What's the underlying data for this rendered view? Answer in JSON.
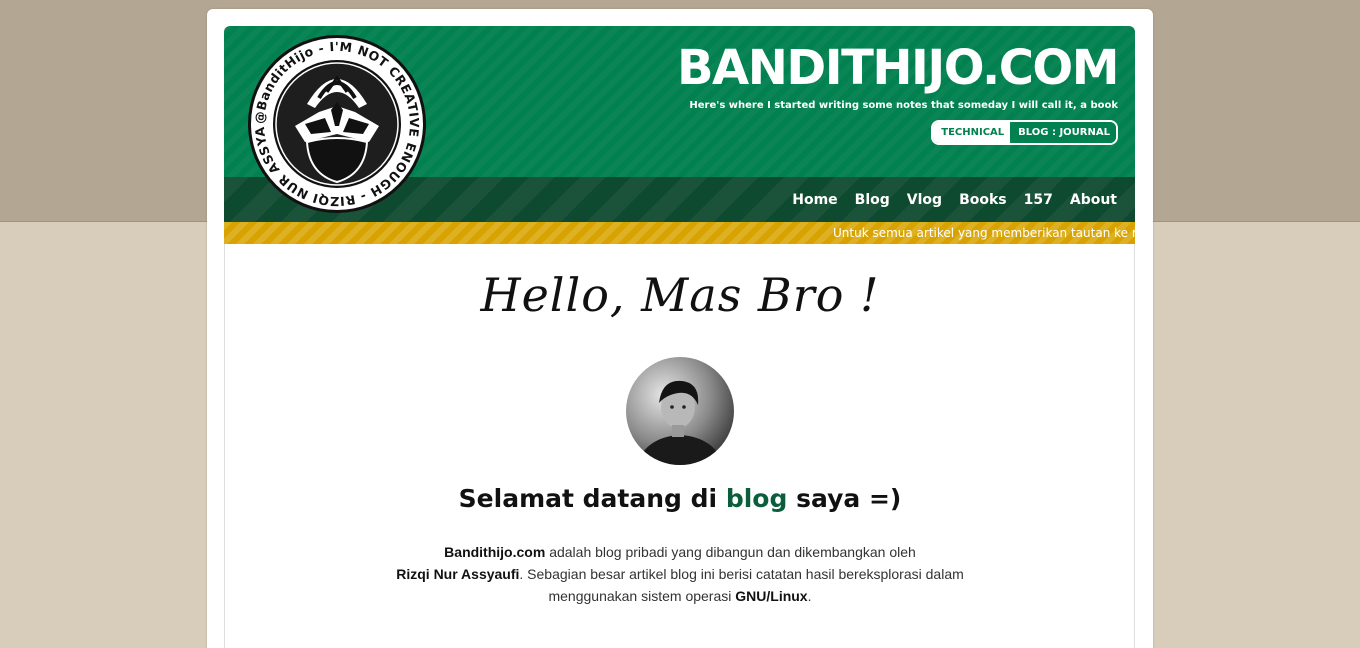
{
  "header": {
    "site_title": "BANDITHIJO.COM",
    "tagline": "Here's where I started writing some notes that someday I will call it, a book",
    "switcher": {
      "technical": "TECHNICAL",
      "blog": "BLOG : JOURNAL"
    }
  },
  "logo": {
    "ring_text": "@BanditHijo - I'M NOT CREATIVE ENOUGH - RIZQI NUR ASSYAUFI -"
  },
  "nav": {
    "items": [
      "Home",
      "Blog",
      "Vlog",
      "Books",
      "157",
      "About"
    ]
  },
  "ticker": {
    "text": "Untuk semua artikel yang memberikan tautan ke rep"
  },
  "main": {
    "greeting": "Hello, Mas Bro !",
    "welcome_prefix": "Selamat datang di",
    "welcome_link": "blog",
    "welcome_suffix": "saya =)",
    "intro_site": "Bandithijo.com",
    "intro_part1": "adalah blog pribadi yang dibangun dan dikembangkan oleh",
    "intro_author": "Rizqi Nur Assyaufi",
    "intro_part2": ". Sebagian besar artikel blog ini berisi catatan hasil bereksplorasi dalam menggunakan sistem operasi",
    "intro_os": "GNU/Linux",
    "intro_end": "."
  },
  "colors": {
    "brand_green": "#028150",
    "nav_green": "#0e4a30",
    "ticker_yellow": "#d8a300",
    "link_green": "#0b5e3b"
  }
}
